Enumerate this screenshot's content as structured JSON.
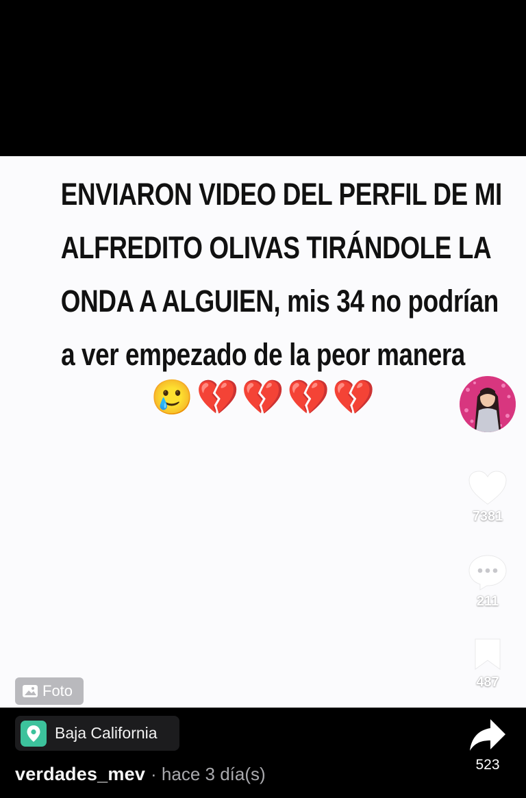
{
  "post": {
    "text_lines": [
      "ENVIARON VIDEO DEL PERFIL DE MI",
      "ALFREDITO OLIVAS TIRÁNDOLE LA",
      "ONDA A ALGUIEN, mis 34 no podrían",
      "a ver empezado de la peor manera"
    ],
    "emojis": [
      "🥲",
      "💔",
      "💔",
      "💔",
      "💔"
    ],
    "media_badge": "Foto"
  },
  "rail": {
    "likes": "7381",
    "comments": "211",
    "saves": "487",
    "shares": "523"
  },
  "location": {
    "label": "Baja California"
  },
  "author": {
    "username": "verdades_mev",
    "time": "· hace 3 día(s)"
  },
  "colors": {
    "location_pin_bg": "#3cc29c",
    "badge_bg": "#b9b9bd",
    "heart_emoji": "#e0222c"
  },
  "icons": {
    "like": "heart-icon",
    "comment": "comment-bubble-icon",
    "save": "bookmark-icon",
    "share": "share-arrow-icon",
    "badge": "image-icon",
    "location": "location-pin-icon"
  }
}
